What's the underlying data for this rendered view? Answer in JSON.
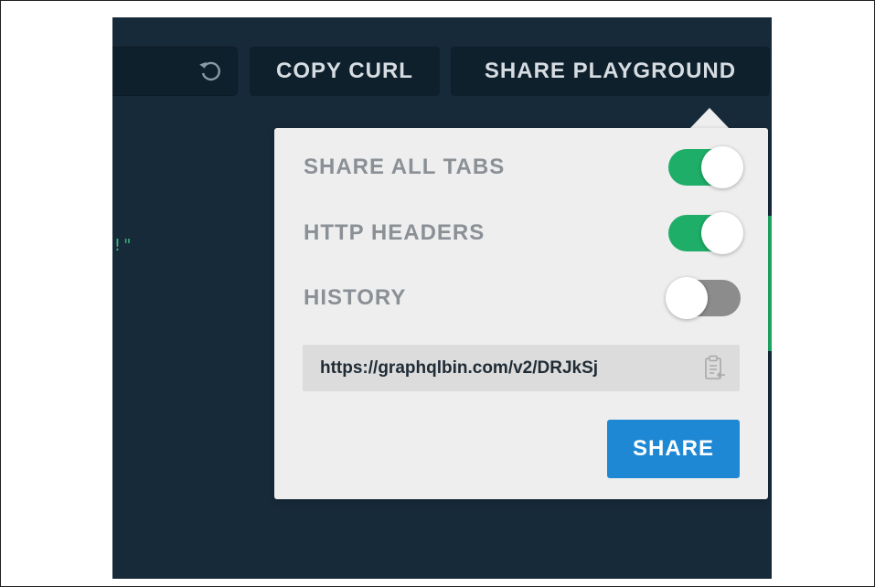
{
  "toolbar": {
    "copy_curl_label": "COPY CURL",
    "share_playground_label": "SHARE PLAYGROUND",
    "reload_icon": "reload-icon"
  },
  "editor": {
    "code_fragment": "!\""
  },
  "share_popover": {
    "options": [
      {
        "label": "SHARE ALL TABS",
        "enabled": true
      },
      {
        "label": "HTTP HEADERS",
        "enabled": true
      },
      {
        "label": "HISTORY",
        "enabled": false
      }
    ],
    "share_url": "https://graphqlbin.com/v2/DRJkSj",
    "copy_icon": "clipboard-icon",
    "share_label": "SHARE"
  },
  "colors": {
    "background_dark": "#172a3a",
    "toggle_on": "#1eae68",
    "toggle_off": "#8c8c8c",
    "share_button": "#1e88d4",
    "popover_bg": "#eeeeee"
  }
}
